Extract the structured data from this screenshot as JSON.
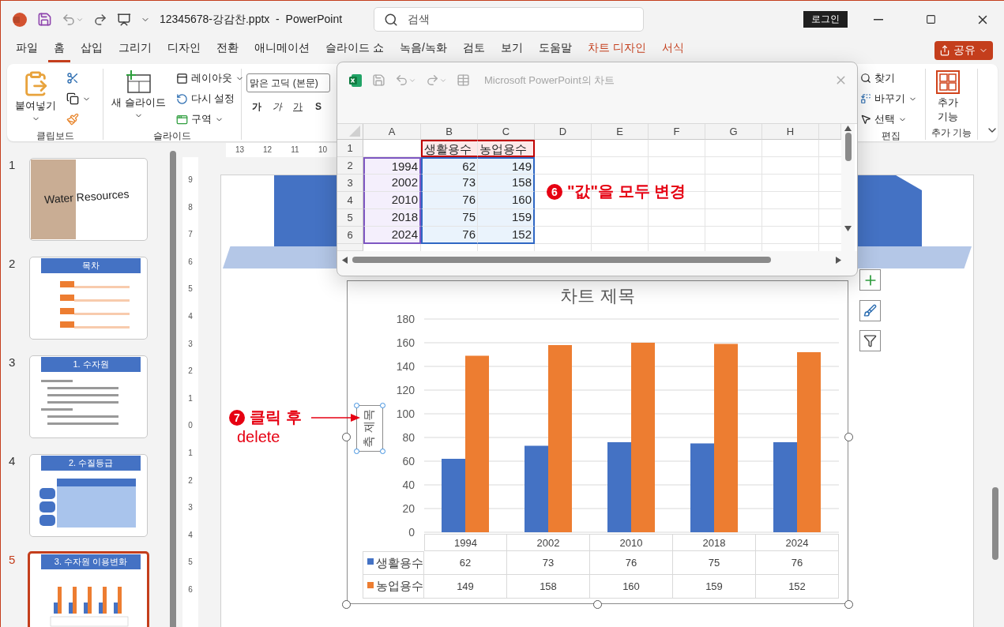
{
  "window": {
    "file_title": "12345678-강감찬.pptx",
    "separator": "-",
    "app": "PowerPoint",
    "search_placeholder": "검색",
    "login": "로그인",
    "share": "공유"
  },
  "menu_tabs": [
    {
      "label": "파일",
      "kind": "normal",
      "selected": false
    },
    {
      "label": "홈",
      "kind": "normal",
      "selected": true
    },
    {
      "label": "삽입",
      "kind": "normal",
      "selected": false
    },
    {
      "label": "그리기",
      "kind": "normal",
      "selected": false
    },
    {
      "label": "디자인",
      "kind": "normal",
      "selected": false
    },
    {
      "label": "전환",
      "kind": "normal",
      "selected": false
    },
    {
      "label": "애니메이션",
      "kind": "normal",
      "selected": false
    },
    {
      "label": "슬라이드 쇼",
      "kind": "normal",
      "selected": false
    },
    {
      "label": "녹음/녹화",
      "kind": "normal",
      "selected": false
    },
    {
      "label": "검토",
      "kind": "normal",
      "selected": false
    },
    {
      "label": "보기",
      "kind": "normal",
      "selected": false
    },
    {
      "label": "도움말",
      "kind": "normal",
      "selected": false
    },
    {
      "label": "차트 디자인",
      "kind": "contextual",
      "selected": false
    },
    {
      "label": "서식",
      "kind": "contextual",
      "selected": false
    }
  ],
  "ribbon": {
    "clipboard": {
      "label": "클립보드",
      "paste": "붙여넣기"
    },
    "slides": {
      "label": "슬라이드",
      "new_slide": "새 슬라이드",
      "layout": "레이아웃",
      "reset": "다시 설정",
      "section": "구역"
    },
    "font": {
      "font_name": "맑은 고딕 (본문)",
      "bold": "가",
      "italic": "가",
      "underline": "가",
      "shadow": "S"
    },
    "editing": {
      "label": "편집",
      "find": "찾기",
      "replace": "바꾸기",
      "select": "선택"
    },
    "addins": {
      "label": "추가 기능",
      "button": "추가 기능"
    }
  },
  "rulers": {
    "horizontal": [
      "13",
      "12",
      "11",
      "10"
    ],
    "vertical": [
      "9",
      "8",
      "7",
      "6",
      "5",
      "4",
      "3",
      "2",
      "1",
      "0",
      "1",
      "2",
      "3",
      "4",
      "5",
      "6"
    ]
  },
  "slides": [
    {
      "number": "1",
      "title": "Water Resources",
      "kind": "cover",
      "selected": false
    },
    {
      "number": "2",
      "title": "목차",
      "kind": "list",
      "selected": false
    },
    {
      "number": "3",
      "title": "1. 수자원",
      "kind": "text",
      "selected": false
    },
    {
      "number": "4",
      "title": "2. 수질등급",
      "kind": "table",
      "selected": false
    },
    {
      "number": "5",
      "title": "3. 수자원 이용변화",
      "kind": "chart",
      "selected": true
    }
  ],
  "slide": {
    "chart_data": {
      "type": "bar",
      "title": "차트 제목",
      "ylabel": "축 제목",
      "categories": [
        "1994",
        "2002",
        "2010",
        "2018",
        "2024"
      ],
      "series": [
        {
          "name": "생활용수",
          "color": "#4472c4",
          "values": [
            62,
            73,
            76,
            75,
            76
          ]
        },
        {
          "name": "농업용수",
          "color": "#ed7d31",
          "values": [
            149,
            158,
            160,
            159,
            152
          ]
        }
      ],
      "ylim": [
        0,
        180
      ],
      "yticks": [
        0,
        20,
        40,
        60,
        80,
        100,
        120,
        140,
        160,
        180
      ],
      "grid": true,
      "legend": true
    },
    "data_table": {
      "rows": [
        {
          "cells": [
            "62",
            "73",
            "76",
            "75",
            "76"
          ]
        },
        {
          "cells": [
            "149",
            "158",
            "160",
            "159",
            "152"
          ]
        }
      ]
    }
  },
  "data_sheet": {
    "title": "Microsoft PowerPoint의 차트",
    "columns": [
      "A",
      "B",
      "C",
      "D",
      "E",
      "F",
      "G",
      "H"
    ],
    "rows": [
      {
        "number": "1",
        "cells": [
          {
            "kind": "empty"
          },
          {
            "text": "생활용수",
            "kind": "series"
          },
          {
            "text": "농업용수",
            "kind": "series"
          }
        ]
      },
      {
        "number": "2",
        "cells": [
          {
            "text": "1994",
            "kind": "category"
          },
          {
            "text": "62",
            "kind": "value"
          },
          {
            "text": "149",
            "kind": "value"
          }
        ]
      },
      {
        "number": "3",
        "cells": [
          {
            "text": "2002",
            "kind": "category"
          },
          {
            "text": "73",
            "kind": "value"
          },
          {
            "text": "158",
            "kind": "value"
          }
        ]
      },
      {
        "number": "4",
        "cells": [
          {
            "text": "2010",
            "kind": "category"
          },
          {
            "text": "76",
            "kind": "value"
          },
          {
            "text": "160",
            "kind": "value"
          }
        ]
      },
      {
        "number": "5",
        "cells": [
          {
            "text": "2018",
            "kind": "category"
          },
          {
            "text": "75",
            "kind": "value"
          },
          {
            "text": "159",
            "kind": "value"
          }
        ]
      },
      {
        "number": "6",
        "cells": [
          {
            "text": "2024",
            "kind": "category"
          },
          {
            "text": "76",
            "kind": "value"
          },
          {
            "text": "152",
            "kind": "value"
          }
        ]
      }
    ]
  },
  "annotations": [
    {
      "number": "6",
      "lines": [
        "\"값\"을 모두 변경"
      ]
    },
    {
      "number": "7",
      "lines": [
        "클릭 후",
        "delete"
      ]
    }
  ]
}
